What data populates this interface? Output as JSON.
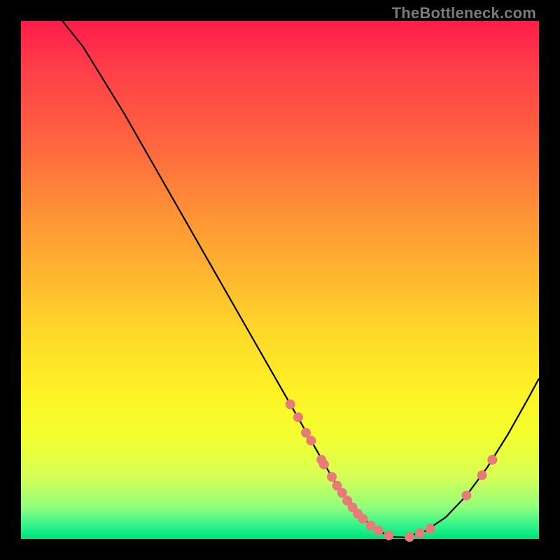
{
  "watermark": "TheBottleneck.com",
  "colors": {
    "dots": "#e77b77",
    "curve": "#000000",
    "page_bg": "#000000"
  },
  "chart_data": {
    "type": "line",
    "title": "",
    "xlabel": "",
    "ylabel": "",
    "xlim": [
      0,
      100
    ],
    "ylim": [
      0,
      100
    ],
    "grid": false,
    "legend": false,
    "curve": {
      "x": [
        8,
        12,
        16,
        20,
        24,
        28,
        32,
        36,
        40,
        44,
        48,
        52,
        56,
        58,
        60,
        62,
        64,
        66,
        68,
        70,
        72,
        74,
        78,
        82,
        86,
        90,
        94,
        98,
        100
      ],
      "y": [
        100,
        95,
        88.5,
        82,
        75,
        68,
        61,
        54,
        47,
        40,
        33,
        26,
        19,
        15.5,
        12,
        9,
        6.2,
        4,
        2.3,
        1.1,
        0.4,
        0.3,
        1.5,
        4.2,
        8.4,
        13.8,
        20.2,
        27.3,
        31
      ]
    },
    "points": [
      {
        "x": 52,
        "y": 26
      },
      {
        "x": 53.5,
        "y": 23.5
      },
      {
        "x": 55,
        "y": 20.5
      },
      {
        "x": 56,
        "y": 19
      },
      {
        "x": 58,
        "y": 15.3
      },
      {
        "x": 58.5,
        "y": 14.4
      },
      {
        "x": 60,
        "y": 12
      },
      {
        "x": 61,
        "y": 10.3
      },
      {
        "x": 62,
        "y": 8.9
      },
      {
        "x": 63,
        "y": 7.4
      },
      {
        "x": 64,
        "y": 6.1
      },
      {
        "x": 65,
        "y": 4.9
      },
      {
        "x": 66,
        "y": 3.9
      },
      {
        "x": 67.5,
        "y": 2.6
      },
      {
        "x": 69,
        "y": 1.6
      },
      {
        "x": 71,
        "y": 0.7
      },
      {
        "x": 75,
        "y": 0.4
      },
      {
        "x": 77,
        "y": 1.1
      },
      {
        "x": 79,
        "y": 2.0
      },
      {
        "x": 86,
        "y": 8.4
      },
      {
        "x": 89,
        "y": 12.3
      },
      {
        "x": 91,
        "y": 15.3
      }
    ],
    "point_radius": 7
  }
}
